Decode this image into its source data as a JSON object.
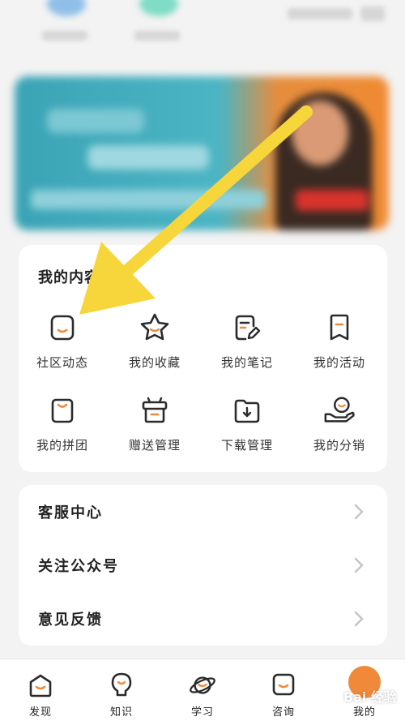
{
  "my_content": {
    "title": "我的内容",
    "items": [
      {
        "label": "社区动态",
        "icon": "face-square-icon"
      },
      {
        "label": "我的收藏",
        "icon": "star-icon"
      },
      {
        "label": "我的笔记",
        "icon": "note-edit-icon"
      },
      {
        "label": "我的活动",
        "icon": "bookmark-flag-icon"
      },
      {
        "label": "我的拼团",
        "icon": "bag-icon"
      },
      {
        "label": "赠送管理",
        "icon": "gift-box-icon"
      },
      {
        "label": "下载管理",
        "icon": "download-icon"
      },
      {
        "label": "我的分销",
        "icon": "hand-coin-icon"
      }
    ]
  },
  "menu": [
    {
      "label": "客服中心"
    },
    {
      "label": "关注公众号"
    },
    {
      "label": "意见反馈"
    }
  ],
  "bottom_nav": [
    {
      "label": "发现"
    },
    {
      "label": "知识"
    },
    {
      "label": "学习"
    },
    {
      "label": "咨询"
    },
    {
      "label": "我的"
    }
  ],
  "watermark": "Bai 经验",
  "colors": {
    "accent_orange": "#f08a3a",
    "arrow_yellow": "#f6d63a",
    "icon_stroke": "#2b2b2b"
  }
}
